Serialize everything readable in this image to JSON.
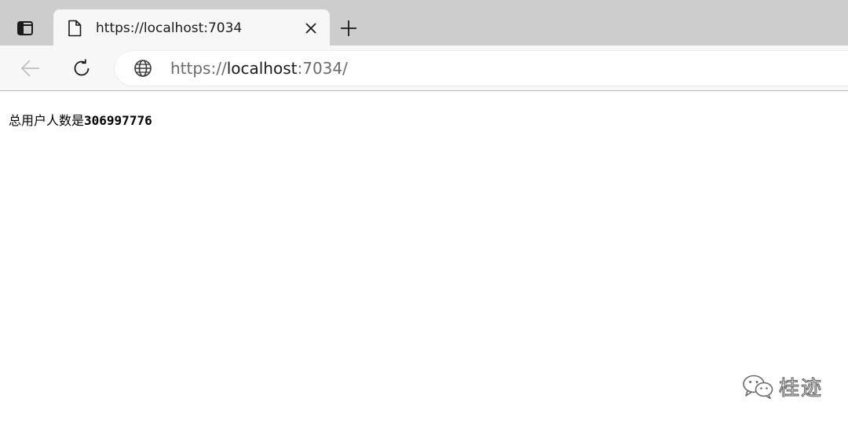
{
  "browser": {
    "tab": {
      "title": "https://localhost:7034"
    },
    "address_bar": {
      "url_scheme": "https://",
      "url_host": "localhost",
      "url_rest": ":7034/"
    },
    "icons": {
      "tab_actions": "tab-actions-icon",
      "page": "document-icon",
      "close": "close-icon",
      "new_tab": "plus-icon",
      "back": "arrow-left-icon",
      "reload": "reload-icon",
      "site": "globe-icon"
    },
    "colors": {
      "tab_strip": "#cdcdcd",
      "toolbar": "#f7f7f7",
      "back_disabled": "#c0c0c0"
    }
  },
  "page": {
    "text_label": "总用户人数是",
    "user_count": "306997776"
  },
  "watermark": {
    "text": "桂迹"
  }
}
